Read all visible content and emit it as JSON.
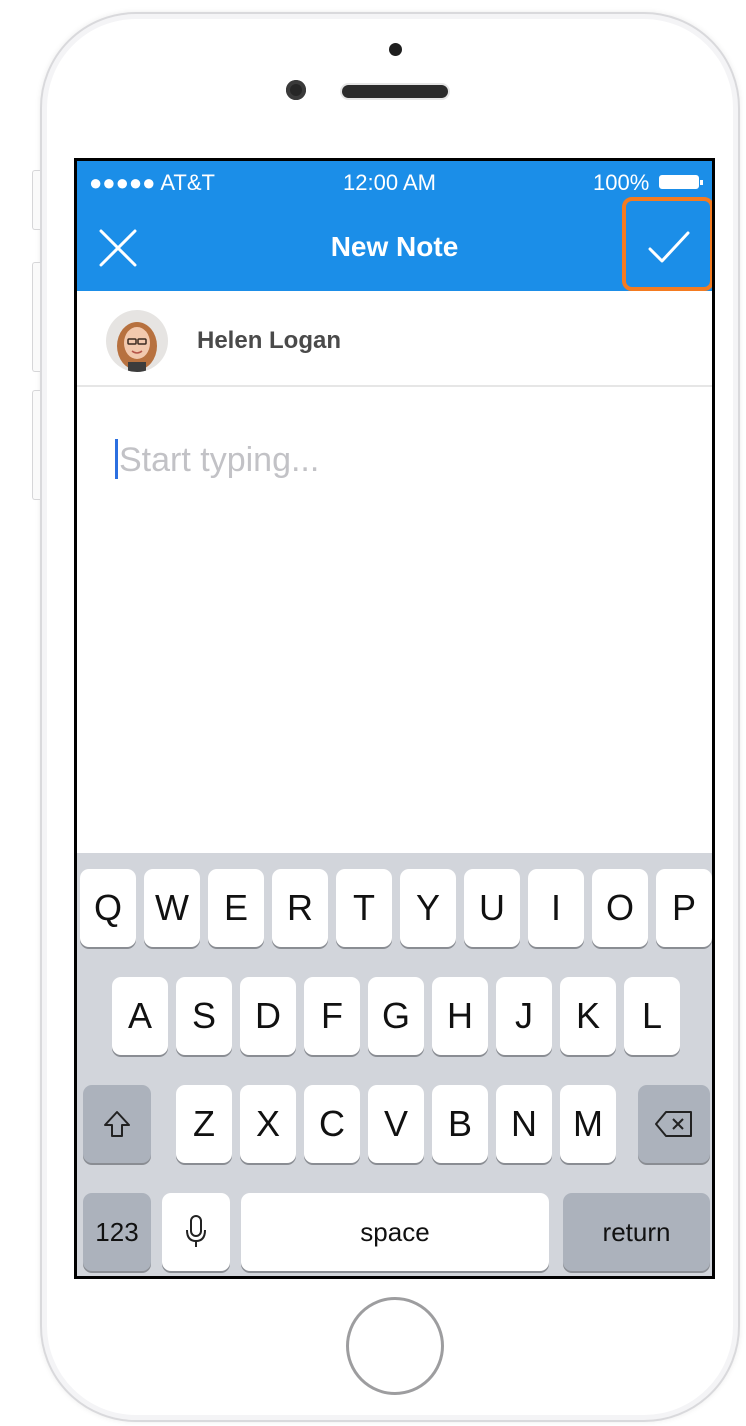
{
  "status_bar": {
    "carrier": "●●●●● AT&T",
    "time": "12:00 AM",
    "battery": "100%"
  },
  "nav": {
    "title": "New Note",
    "close_icon": "close-icon",
    "done_icon": "checkmark-icon",
    "accent_color": "#1b8ee8",
    "highlight_color": "#f47b20"
  },
  "author": {
    "name": "Helen Logan"
  },
  "note": {
    "placeholder": "Start typing..."
  },
  "keyboard": {
    "row1": [
      "Q",
      "W",
      "E",
      "R",
      "T",
      "Y",
      "U",
      "I",
      "O",
      "P"
    ],
    "row2": [
      "A",
      "S",
      "D",
      "F",
      "G",
      "H",
      "J",
      "K",
      "L"
    ],
    "row3": [
      "Z",
      "X",
      "C",
      "V",
      "B",
      "N",
      "M"
    ],
    "numbers_label": "123",
    "space_label": "space",
    "return_label": "return"
  }
}
